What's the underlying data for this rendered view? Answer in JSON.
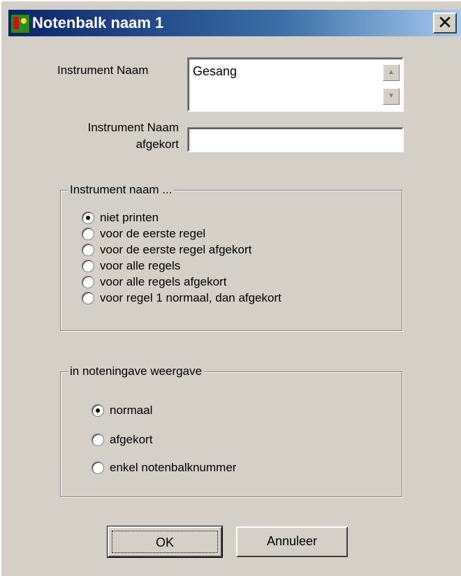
{
  "window": {
    "title": "Notenbalk naam 1",
    "close_glyph": "✕"
  },
  "instrument_name": {
    "label": "Instrument Naam",
    "value": "Gesang"
  },
  "abbrev_name": {
    "label_line1": "Instrument Naam",
    "label_line2": "afgekort",
    "value": ""
  },
  "print_group": {
    "legend": "Instrument naam ...",
    "options": [
      {
        "label": "niet printen",
        "selected": true
      },
      {
        "label": "voor de eerste regel",
        "selected": false
      },
      {
        "label": "voor de eerste regel afgekort",
        "selected": false
      },
      {
        "label": "voor alle regels",
        "selected": false
      },
      {
        "label": "voor alle regels afgekort",
        "selected": false
      },
      {
        "label": "voor regel 1 normaal, dan afgekort",
        "selected": false
      }
    ]
  },
  "display_group": {
    "legend": "in noteningave weergave",
    "options": [
      {
        "label": "normaal",
        "selected": true
      },
      {
        "label": "afgekort",
        "selected": false
      },
      {
        "label": "enkel notenbalknummer",
        "selected": false
      }
    ]
  },
  "buttons": {
    "ok": "OK",
    "cancel": "Annuleer"
  },
  "colors": {
    "face": "#d4d0c8",
    "title_start": "#0a246a",
    "title_end": "#a6caf0"
  }
}
